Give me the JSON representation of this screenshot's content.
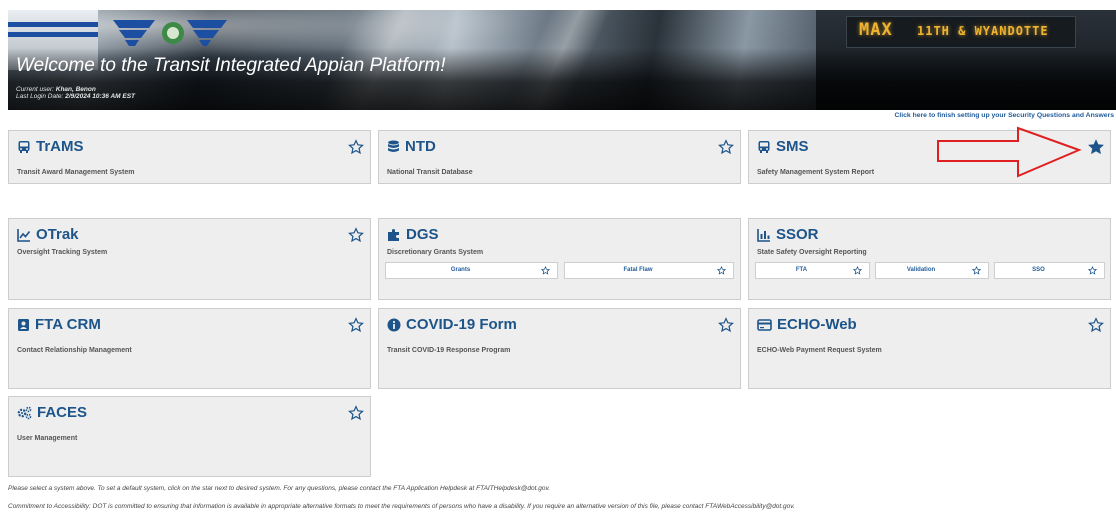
{
  "banner": {
    "welcome": "Welcome to the Transit Integrated Appian Platform!",
    "current_user_label": "Current user:",
    "current_user": "Khan, Benon",
    "last_login_label": "Last Login Date:",
    "last_login": "2/9/2024 10:36 AM EST",
    "sign_left": "MAX",
    "sign_right": "11TH & WYANDOTTE"
  },
  "security_link": "Click here to finish setting up your Security Questions and Answers",
  "cards": {
    "trams": {
      "title": "TrAMS",
      "subtitle": "Transit Award Management System",
      "icon": "bus-icon"
    },
    "ntd": {
      "title": "NTD",
      "subtitle": "National Transit Database",
      "icon": "database-icon"
    },
    "sms": {
      "title": "SMS",
      "subtitle": "Safety Management System Report",
      "icon": "bus-icon",
      "default": true
    },
    "otrak": {
      "title": "OTrak",
      "subtitle": "Oversight Tracking System",
      "icon": "line-chart-icon"
    },
    "dgs": {
      "title": "DGS",
      "subtitle": "Discretionary Grants System",
      "icon": "puzzle-icon",
      "sub_items": [
        "Grants",
        "Fatal Flaw"
      ]
    },
    "ssor": {
      "title": "SSOR",
      "subtitle": "State Safety Oversight Reporting",
      "icon": "bar-chart-icon",
      "sub_items": [
        "FTA",
        "Validation",
        "SSO"
      ]
    },
    "ftacrm": {
      "title": "FTA CRM",
      "subtitle": "Contact Relationship Management",
      "icon": "contact-card-icon"
    },
    "covid": {
      "title": "COVID-19 Form",
      "subtitle": "Transit COVID-19 Response Program",
      "icon": "info-circle-icon"
    },
    "echo": {
      "title": "ECHO-Web",
      "subtitle": "ECHO-Web Payment Request System",
      "icon": "payment-card-icon"
    },
    "faces": {
      "title": "FACES",
      "subtitle": "User Management",
      "icon": "gears-icon"
    }
  },
  "footer": {
    "instructions": "Please select a system above. To set a default system, click on the star next to desired system. For any questions, please contact the FTA Application Helpdesk at FTAITHelpdesk@dot.gov.",
    "accessibility": "Commitment to Accessibility: DOT is committed to ensuring that information is available in appropriate alternative formats to meet the requirements of persons who have a disability. If you require an alternative version of this file, please contact FTAWebAccessibility@dot.gov."
  },
  "colors": {
    "title_blue": "#1d5489",
    "annotation_red": "#e02020",
    "card_bg": "#eeeeee"
  }
}
